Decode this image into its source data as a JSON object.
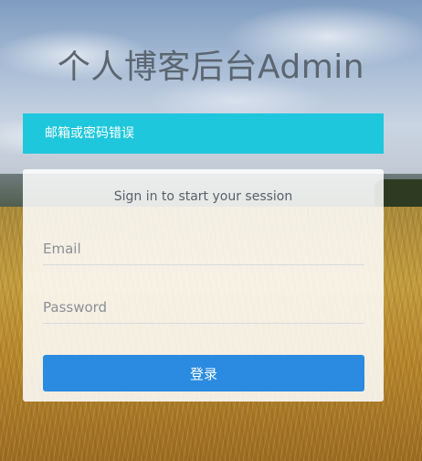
{
  "header": {
    "title": "个人博客后台Admin"
  },
  "alert": {
    "message": "邮箱或密码错误"
  },
  "login_box": {
    "message": "Sign in to start your session",
    "email": {
      "placeholder": "Email",
      "value": ""
    },
    "password": {
      "placeholder": "Password",
      "value": ""
    },
    "submit_label": "登录"
  },
  "colors": {
    "alert_bg": "#1fc7dc",
    "button_bg": "#2a8be0",
    "title_text": "#5b6670"
  }
}
